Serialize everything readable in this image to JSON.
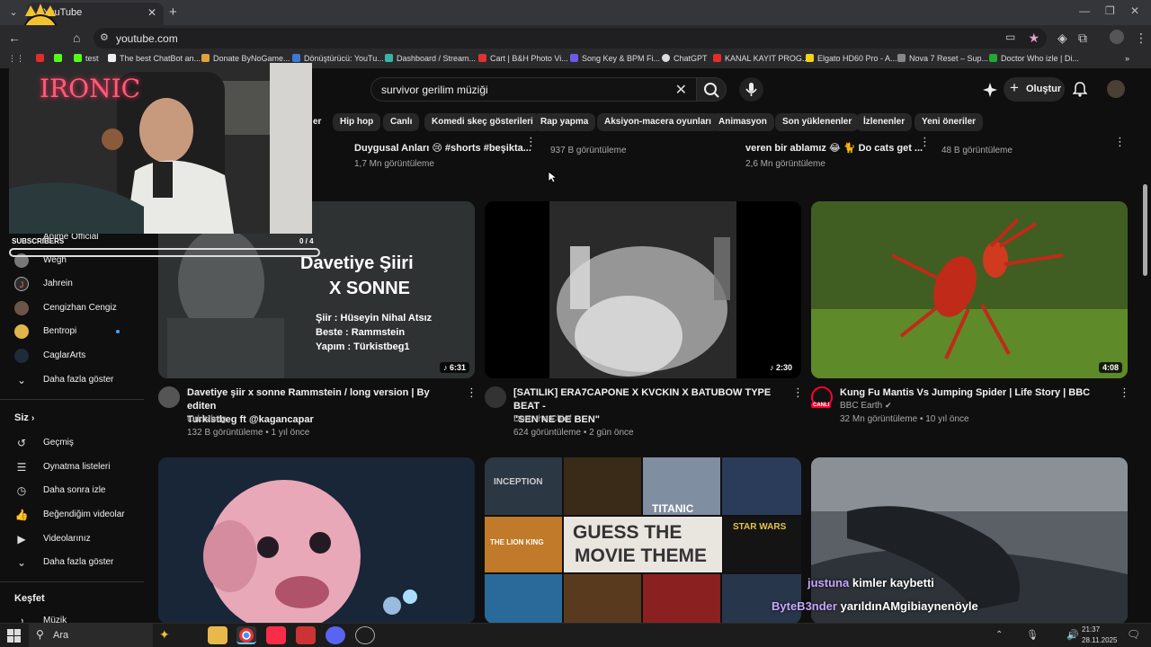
{
  "browser": {
    "tab_title": "YouTube",
    "url": "youtube.com",
    "bookmarks": [
      "test",
      "The best ChatBot an...",
      "Donate ByNoGame...",
      "Dönüştürücü: YouTu...",
      "Dashboard / Stream...",
      "Cart | B&H Photo Vi...",
      "Song Key & BPM Fi...",
      "ChatGPT",
      "KANAL KAYIT PROG...",
      "Elgato HD60 Pro - A...",
      "Nova 7 Reset – Sup...",
      "Doctor Who izle | Di..."
    ]
  },
  "header": {
    "search_query": "survivor gerilim müziği",
    "create_label": "Oluştur"
  },
  "chips": [
    "er",
    "Hip hop",
    "Canlı",
    "Komedi skeç gösterileri",
    "Rap yapma",
    "Aksiyon-macera oyunları",
    "Animasyon",
    "Son yüklenenler",
    "İzlenenler",
    "Yeni öneriler"
  ],
  "top_row": [
    {
      "title": "Duygusal Anları 😢 #shorts #beşikta...",
      "meta": "1,7 Mn görüntüleme"
    },
    {
      "title": "",
      "meta": "937 B görüntüleme"
    },
    {
      "title": "veren bir ablamız 😂 🐈 Do cats get ...",
      "meta": "2,6 Mn görüntüleme"
    },
    {
      "title": "",
      "meta": "48 B görüntüleme"
    }
  ],
  "sidebar": {
    "subscribers_label": "SUBSCRIBERS",
    "subscribers_count": "0 / 4",
    "partial_item": "Anime Official",
    "channels": [
      {
        "label": "Wegh"
      },
      {
        "label": "Jahrein"
      },
      {
        "label": "Cengizhan Cengiz"
      },
      {
        "label": "Bentropi"
      },
      {
        "label": "CaglarArts"
      }
    ],
    "show_more": "Daha fazla göster",
    "you_heading": "Siz",
    "you_items": [
      "Geçmiş",
      "Oynatma listeleri",
      "Daha sonra izle",
      "Beğendiğim videolar",
      "Videolarınız"
    ],
    "show_more_2": "Daha fazla göster",
    "explore_heading": "Keşfet",
    "explore_items": [
      "Müzik"
    ]
  },
  "cam": {
    "neon_text": "IRONIC"
  },
  "videos": [
    {
      "title_line1": "Davetiye şiir x sonne Rammstein / long version | By editen",
      "title_line2": "Turkistbeg ft @kagancapar",
      "channel": "türkistbeg",
      "meta": "132 B görüntüleme • 1 yıl önce",
      "duration": "6:31",
      "thumb_lines": [
        "Davetiye Şiiri",
        "X SONNE"
      ],
      "thumb_credits": [
        "Şiir : Hüseyin Nihal Atsız",
        "Beste : Rammstein",
        "Yapım : Türkistbeg1"
      ]
    },
    {
      "title_line1": "[SATILIK] ERA7CAPONE X KVCKIN X BATUBOW TYPE BEAT -",
      "title_line2": "\"SEN NE DE BEN\"",
      "channel": "Doro the Chief",
      "meta": "624 görüntüleme • 2 gün önce",
      "duration": "2:30"
    },
    {
      "title_line1": "Kung Fu Mantis Vs Jumping Spider | Life Story | BBC",
      "title_line2": "",
      "channel": "BBC Earth",
      "meta": "32 Mn görüntüleme • 10 yıl önce",
      "duration": "4:08",
      "live_label": "CANLI"
    }
  ],
  "bottom_thumbs": {
    "movie_titles": [
      "INCEPTION",
      "TITANIC",
      "THE LION KING",
      "STAR WARS"
    ],
    "guess_text": [
      "GUESS THE",
      "MOVIE THEME"
    ],
    "chat_1_user": "justuna",
    "chat_1_msg": "kimler kaybetti",
    "chat_2_user": "ByteB3nder",
    "chat_2_msg": "yarıldınAMgibiaynenöyle"
  },
  "taskbar": {
    "search_label": "Ara",
    "time": "21:37",
    "date": "28.11.2025"
  },
  "colors": {
    "bg": "#0f0f0f",
    "chip": "#272727",
    "accent_red": "#ff0033"
  }
}
